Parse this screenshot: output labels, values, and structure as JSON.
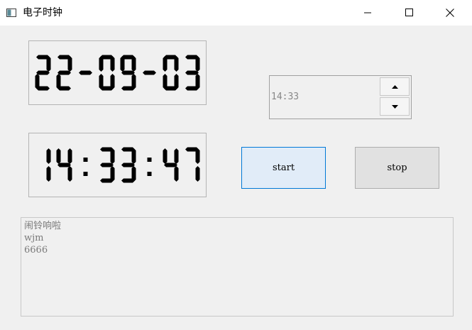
{
  "window": {
    "title": "电子时钟",
    "icons": [
      "app-icon",
      "minimize-icon",
      "maximize-icon",
      "close-icon"
    ]
  },
  "clock": {
    "date": "22-09-03",
    "time": "14:33:47"
  },
  "alarm": {
    "time_value": "14:33",
    "spin_icons": [
      "spin-up-icon",
      "spin-down-icon"
    ]
  },
  "buttons": {
    "start_label": "start",
    "stop_label": "stop"
  },
  "log": {
    "lines": [
      "闹铃响啦",
      "wjm",
      "6666"
    ]
  },
  "colors": {
    "background": "#f0f0f0",
    "lcd_digit": "#000000",
    "start_bg": "#e1ecf8",
    "start_border": "#0078d7"
  }
}
